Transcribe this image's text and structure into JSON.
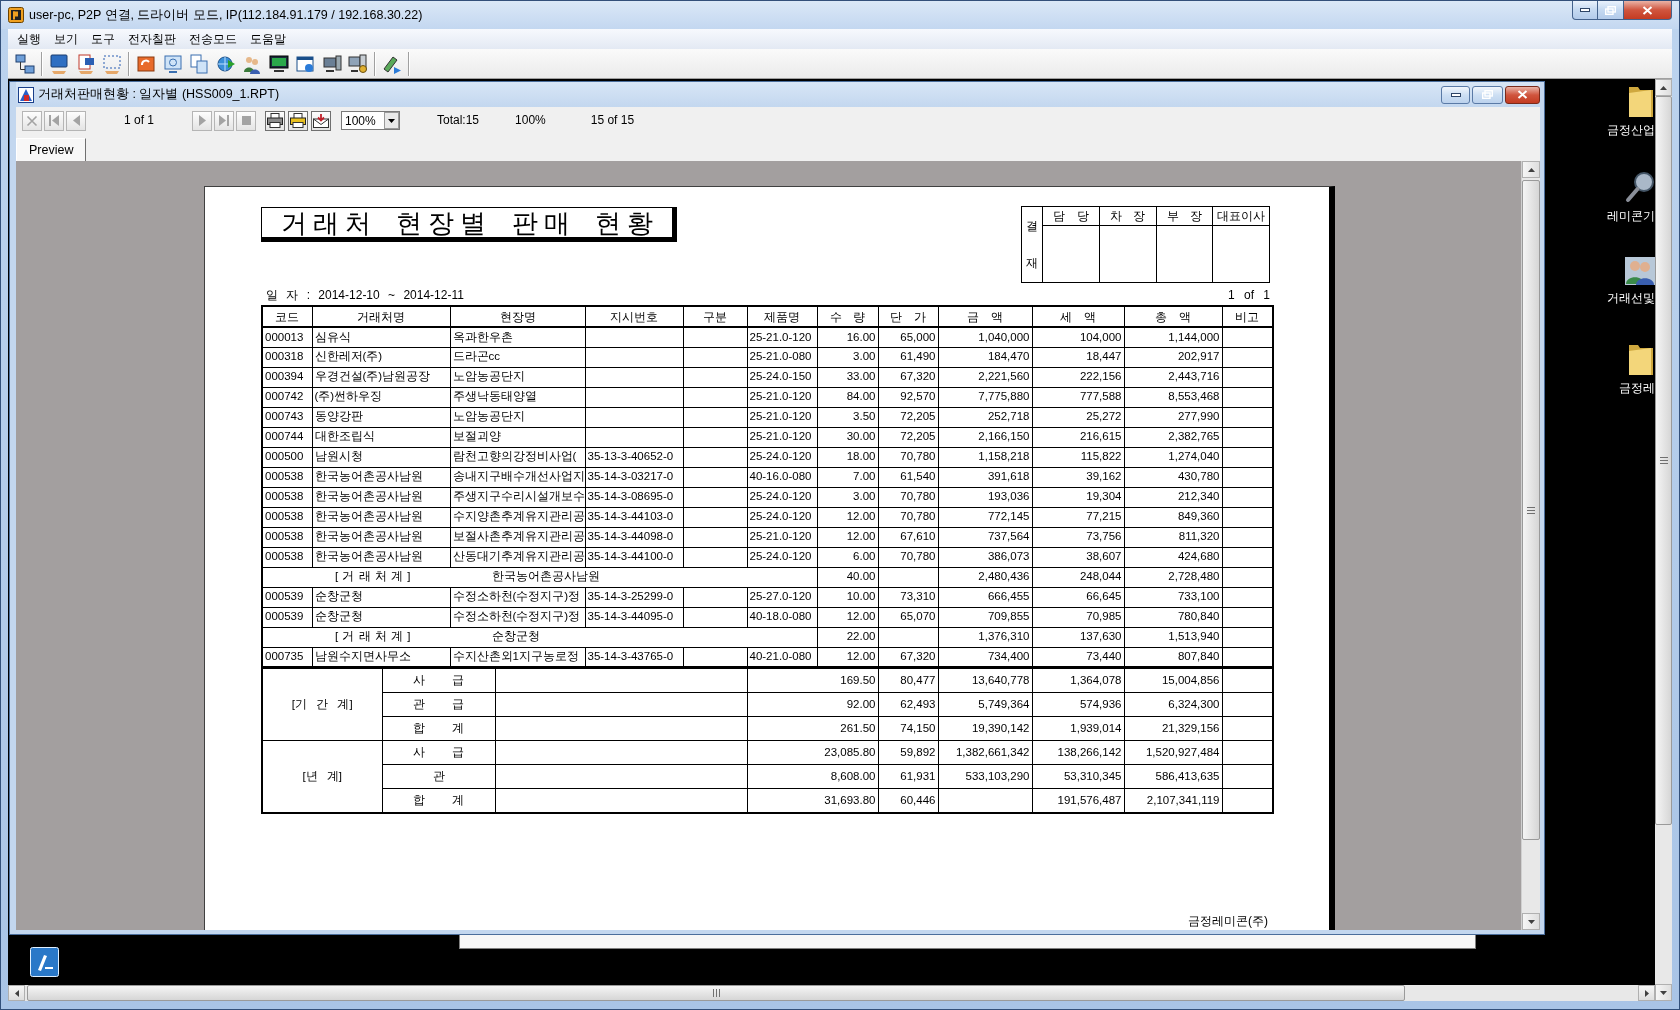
{
  "window": {
    "title": "user-pc, P2P 연결, 드라이버 모드, IP(112.184.91.179 / 192.168.30.22)"
  },
  "menu": [
    "실행",
    "보기",
    "도구",
    "전자칠판",
    "전송모드",
    "도움말"
  ],
  "report_window": {
    "title": "거래처판매현황 : 일자별 (HSS009_1.RPT)",
    "toolbar": {
      "nav_back": [
        {
          "kind": "cancel",
          "disabled": true
        },
        {
          "kind": "first",
          "disabled": true
        },
        {
          "kind": "previous",
          "disabled": true
        }
      ],
      "page": "1 of 1",
      "nav_forward": [
        {
          "kind": "next",
          "disabled": true
        },
        {
          "kind": "last",
          "disabled": true
        },
        {
          "kind": "stop",
          "disabled": true
        }
      ],
      "output": [
        {
          "kind": "print"
        },
        {
          "kind": "print_setup"
        },
        {
          "kind": "export"
        }
      ],
      "zoom": "100%",
      "total": "Total:15",
      "zoom_reading": "100%",
      "records": "15 of 15"
    },
    "tabs": [
      {
        "label": "Preview",
        "selected": true
      }
    ]
  },
  "report": {
    "title": "거래처 현장별 판매 현황",
    "approval": {
      "side": [
        "결",
        "재"
      ],
      "columns": [
        "담 당",
        "차 장",
        "부 장",
        "대표이사"
      ]
    },
    "date_range": "일 자 : 2014-12-10 ~ 2014-12-11",
    "page": "1 of 1",
    "table": {
      "columns": [
        "코드",
        "거래처명",
        "현장명",
        "지시번호",
        "구분",
        "제품명",
        "수 량",
        "단 가",
        "금 액",
        "세 액",
        "총 액",
        "비고"
      ],
      "rows": [
        {
          "kind": "item",
          "code": "000013",
          "customer": "심유식",
          "site": "옥과한우촌",
          "product": "25-21.0-120",
          "qty": "16.00",
          "price": "65,000",
          "amount": "1,040,000",
          "tax": "104,000",
          "total": "1,144,000"
        },
        {
          "kind": "item",
          "code": "000318",
          "customer": "신한레저(주)",
          "site": "드라곤cc",
          "product": "25-21.0-080",
          "qty": "3.00",
          "price": "61,490",
          "amount": "184,470",
          "tax": "18,447",
          "total": "202,917"
        },
        {
          "kind": "item",
          "code": "000394",
          "customer": "우경건설(주)남원공장",
          "site": "노암농공단지",
          "product": "25-24.0-150",
          "qty": "33.00",
          "price": "67,320",
          "amount": "2,221,560",
          "tax": "222,156",
          "total": "2,443,716"
        },
        {
          "kind": "item",
          "code": "000742",
          "customer": "(주)썬하우징",
          "site": "주생낙동태양열",
          "product": "25-21.0-120",
          "qty": "84.00",
          "price": "92,570",
          "amount": "7,775,880",
          "tax": "777,588",
          "total": "8,553,468"
        },
        {
          "kind": "item",
          "code": "000743",
          "customer": "동양강판",
          "site": "노암농공단지",
          "product": "25-21.0-120",
          "qty": "3.50",
          "price": "72,205",
          "amount": "252,718",
          "tax": "25,272",
          "total": "277,990"
        },
        {
          "kind": "item",
          "code": "000744",
          "customer": "대한조립식",
          "site": "보절괴양",
          "product": "25-21.0-120",
          "qty": "30.00",
          "price": "72,205",
          "amount": "2,166,150",
          "tax": "216,615",
          "total": "2,382,765"
        },
        {
          "kind": "item",
          "code": "000500",
          "customer": "남원시청",
          "site": "람천고향의강정비사업(",
          "order_no": "35-13-3-40652-0",
          "product": "25-24.0-120",
          "qty": "18.00",
          "price": "70,780",
          "amount": "1,158,218",
          "tax": "115,822",
          "total": "1,274,040"
        },
        {
          "kind": "item",
          "code": "000538",
          "customer": "한국농어촌공사남원",
          "site": "송내지구배수개선사업지",
          "order_no": "35-14-3-03217-0",
          "product": "40-16.0-080",
          "qty": "7.00",
          "price": "61,540",
          "amount": "391,618",
          "tax": "39,162",
          "total": "430,780"
        },
        {
          "kind": "item",
          "code": "000538",
          "customer": "한국농어촌공사남원",
          "site": "주생지구수리시설개보수",
          "order_no": "35-14-3-08695-0",
          "product": "25-24.0-120",
          "qty": "3.00",
          "price": "70,780",
          "amount": "193,036",
          "tax": "19,304",
          "total": "212,340"
        },
        {
          "kind": "item",
          "code": "000538",
          "customer": "한국농어촌공사남원",
          "site": "수지양촌추계유지관리공",
          "order_no": "35-14-3-44103-0",
          "product": "25-24.0-120",
          "qty": "12.00",
          "price": "70,780",
          "amount": "772,145",
          "tax": "77,215",
          "total": "849,360"
        },
        {
          "kind": "item",
          "code": "000538",
          "customer": "한국농어촌공사남원",
          "site": "보절사촌추계유지관리공",
          "order_no": "35-14-3-44098-0",
          "product": "25-21.0-120",
          "qty": "12.00",
          "price": "67,610",
          "amount": "737,564",
          "tax": "73,756",
          "total": "811,320"
        },
        {
          "kind": "item",
          "code": "000538",
          "customer": "한국농어촌공사남원",
          "site": "산동대기추계유지관리공",
          "order_no": "35-14-3-44100-0",
          "product": "25-24.0-120",
          "qty": "6.00",
          "price": "70,780",
          "amount": "386,073",
          "tax": "38,607",
          "total": "424,680"
        },
        {
          "kind": "subtotal",
          "label": "[ 거 래 처 계 ]",
          "customer": "한국농어촌공사남원",
          "qty": "40.00",
          "amount": "2,480,436",
          "tax": "248,044",
          "total": "2,728,480"
        },
        {
          "kind": "item",
          "code": "000539",
          "customer": "순창군청",
          "site": "수정소하천(수정지구)정",
          "order_no": "35-14-3-25299-0",
          "product": "25-27.0-120",
          "qty": "10.00",
          "price": "73,310",
          "amount": "666,455",
          "tax": "66,645",
          "total": "733,100"
        },
        {
          "kind": "item",
          "code": "000539",
          "customer": "순창군청",
          "site": "수정소하천(수정지구)정",
          "order_no": "35-14-3-44095-0",
          "product": "40-18.0-080",
          "qty": "12.00",
          "price": "65,070",
          "amount": "709,855",
          "tax": "70,985",
          "total": "780,840"
        },
        {
          "kind": "subtotal",
          "label": "[ 거 래 처 계 ]",
          "customer": "순창군청",
          "qty": "22.00",
          "amount": "1,376,310",
          "tax": "137,630",
          "total": "1,513,940"
        },
        {
          "kind": "item",
          "code": "000735",
          "customer": "남원수지면사무소",
          "site": "수지산촌외1지구농로정",
          "order_no": "35-14-3-43765-0",
          "product": "40-21.0-080",
          "qty": "12.00",
          "price": "67,320",
          "amount": "734,400",
          "tax": "73,440",
          "total": "807,840"
        }
      ],
      "summary": [
        {
          "label": "[기 간 계]",
          "rows": [
            {
              "label": "사 급",
              "qty": "169.50",
              "price": "80,477",
              "amount": "13,640,778",
              "tax": "1,364,078",
              "total": "15,004,856"
            },
            {
              "label": "관 급",
              "qty": "92.00",
              "price": "62,493",
              "amount": "5,749,364",
              "tax": "574,936",
              "total": "6,324,300"
            },
            {
              "label": "합 계",
              "qty": "261.50",
              "price": "74,150",
              "amount": "19,390,142",
              "tax": "1,939,014",
              "total": "21,329,156"
            }
          ]
        },
        {
          "label": "[년   계]",
          "rows": [
            {
              "label": "사 급",
              "qty": "23,085.80",
              "price": "59,892",
              "amount": "1,382,661,342",
              "tax": "138,266,142",
              "total": "1,520,927,484"
            },
            {
              "label": "관",
              "qty": "8,608.00",
              "price": "61,931",
              "amount": "533,103,290",
              "tax": "53,310,345",
              "total": "586,413,635"
            },
            {
              "label": "합 계",
              "qty": "31,693.80",
              "price": "60,446",
              "tax": "191,576,487",
              "total": "2,107,341,119"
            }
          ]
        }
      ]
    },
    "footer": "금정레미콘(주)"
  },
  "desktop_icons": [
    {
      "kind": "folder",
      "label": "금정산업"
    },
    {
      "kind": "magnifier",
      "label": "레미콘기"
    },
    {
      "kind": "people",
      "label": "거래선및"
    },
    {
      "kind": "folder",
      "label": "금정레"
    }
  ]
}
